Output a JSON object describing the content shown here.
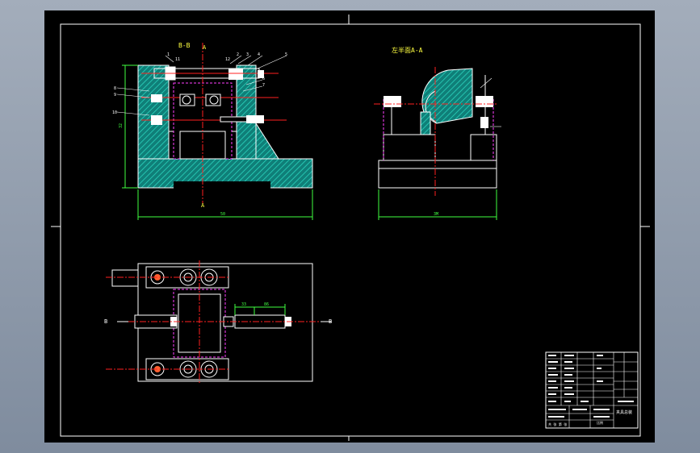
{
  "drawing": {
    "section_top_left": "B-B",
    "section_top_left_mark": "A",
    "section_a_label_bottom": "A",
    "side_view_title": "左半面A-A",
    "bottom_view_left_mark": "B",
    "bottom_view_right_mark": "B",
    "dim_front_width": "50",
    "dim_side_width": "3M",
    "dim_front_height": "32",
    "dim_plan_a": "33",
    "dim_plan_b": "86",
    "callouts": [
      "1",
      "2",
      "3",
      "4",
      "5",
      "6",
      "7",
      "8",
      "9",
      "10",
      "11",
      "12"
    ]
  },
  "colors": {
    "background": "#000000",
    "border": "#ffffff",
    "hatch": "#00b4a0",
    "centerline": "#ff2020",
    "hidden": "#ff40ff",
    "dimension": "#40ff40",
    "annotation": "#ffff40",
    "part": "#ffffff"
  },
  "title_block": {
    "drawing_name": "夹具总装",
    "scale_label": "比例",
    "sheet_label": "共 张 第 张"
  }
}
